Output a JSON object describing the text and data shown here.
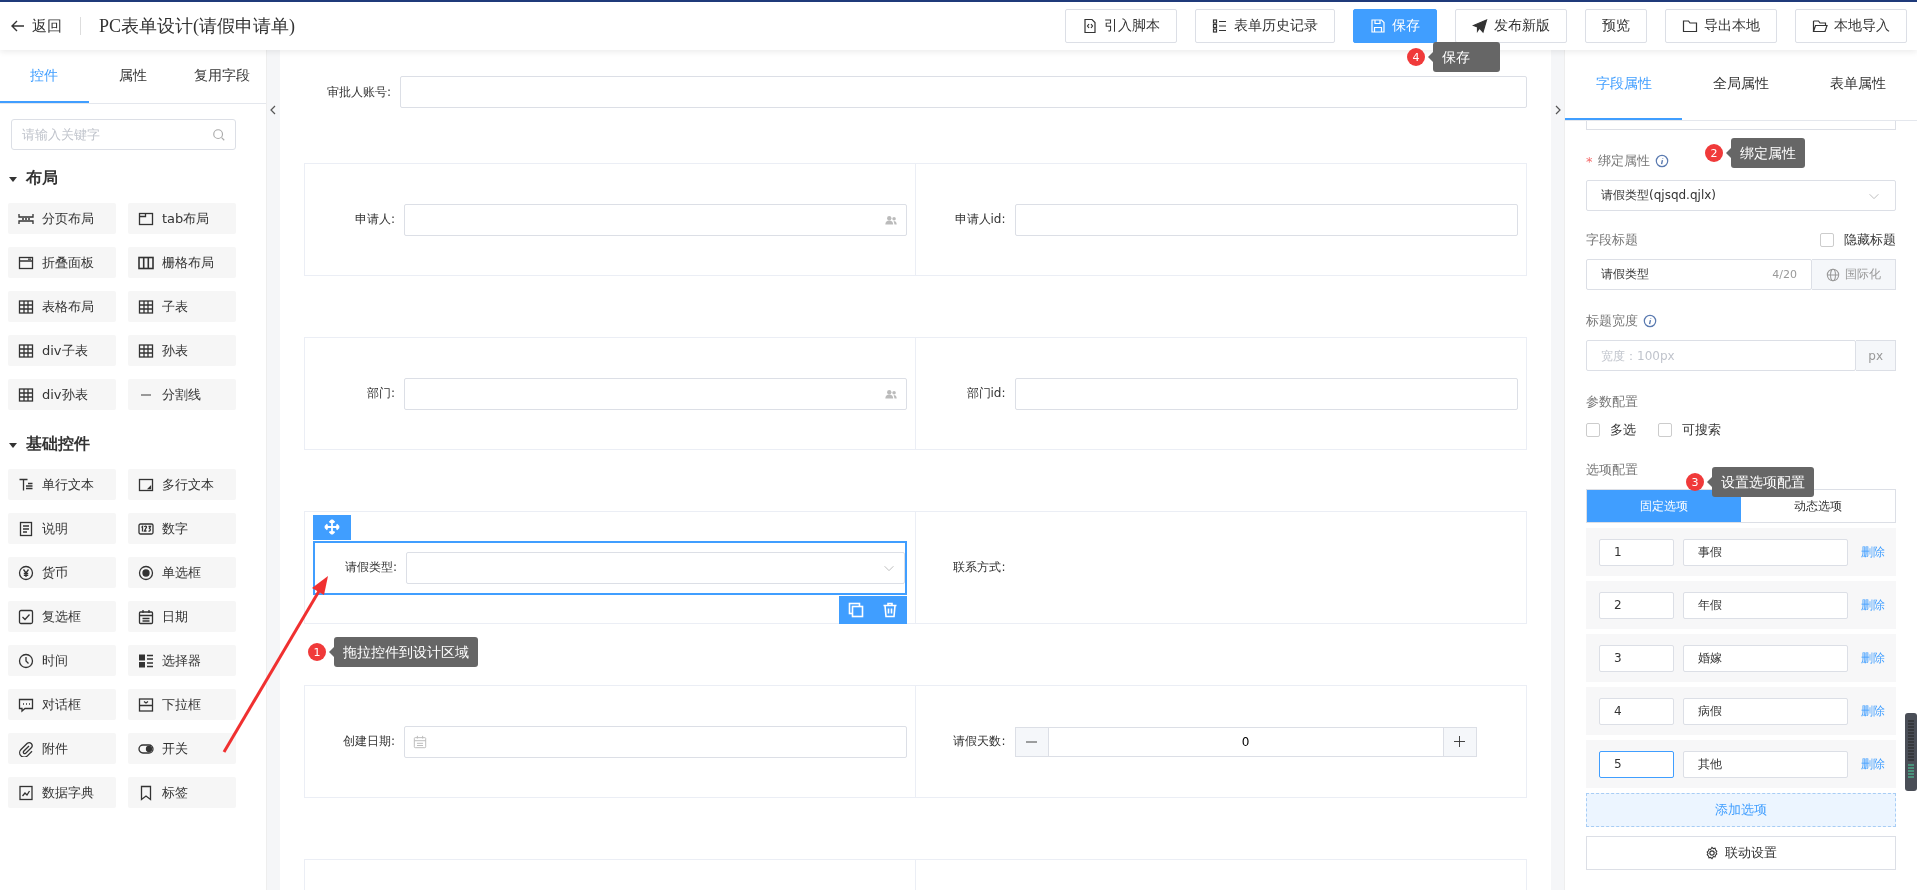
{
  "header": {
    "back": "返回",
    "title": "PC表单设计(请假申请单)",
    "buttons": [
      {
        "label": "引入脚本",
        "primary": false
      },
      {
        "label": "表单历史记录",
        "primary": false
      },
      {
        "label": "保存",
        "primary": true
      },
      {
        "label": "发布新版",
        "primary": false
      },
      {
        "label": "预览",
        "primary": false
      },
      {
        "label": "导出本地",
        "primary": false
      },
      {
        "label": "本地导入",
        "primary": false
      }
    ]
  },
  "left_panel": {
    "tabs": [
      {
        "label": "控件",
        "selected": true
      },
      {
        "label": "属性",
        "selected": false
      },
      {
        "label": "复用字段",
        "selected": false
      }
    ],
    "search": {
      "placeholder": "请输入关键字"
    },
    "groups": [
      {
        "title": "布局",
        "expanded": true,
        "items": [
          "分页布局",
          "tab布局",
          "折叠面板",
          "栅格布局",
          "表格布局",
          "子表",
          "div子表",
          "孙表",
          "div孙表",
          "分割线"
        ]
      },
      {
        "title": "基础控件",
        "expanded": true,
        "items": [
          "单行文本",
          "多行文本",
          "说明",
          "数字",
          "货币",
          "单选框",
          "复选框",
          "日期",
          "时间",
          "选择器",
          "对话框",
          "下拉框",
          "附件",
          "开关",
          "数据字典",
          "标签"
        ]
      }
    ]
  },
  "canvas": {
    "top_field": {
      "label": "审批人账号:"
    },
    "rows": [
      {
        "cells": [
          {
            "label": "申请人:",
            "kind": "user",
            "selected": false
          },
          {
            "label": "申请人id:",
            "kind": "text",
            "selected": false
          }
        ]
      },
      {
        "cells": [
          {
            "label": "部门:",
            "kind": "user",
            "selected": false
          },
          {
            "label": "部门id:",
            "kind": "text",
            "selected": false
          }
        ]
      },
      {
        "cells": [
          {
            "label": "请假类型:",
            "kind": "select",
            "selected": true
          },
          {
            "label": "联系方式:",
            "kind": "none",
            "selected": false
          }
        ]
      },
      {
        "cells": [
          {
            "label": "创建日期:",
            "kind": "date",
            "selected": false
          },
          {
            "label": "请假天数:",
            "kind": "number",
            "value": "0",
            "selected": false
          }
        ]
      }
    ]
  },
  "right_panel": {
    "tabs": [
      {
        "label": "字段属性",
        "selected": true
      },
      {
        "label": "全局属性",
        "selected": false
      },
      {
        "label": "表单属性",
        "selected": false
      }
    ],
    "bind": {
      "required_mark": "*",
      "label": "绑定属性",
      "value": "请假类型(qjsqd.qjlx)"
    },
    "title_field": {
      "label": "字段标题",
      "hide": {
        "label": "隐藏标题",
        "checked": false
      },
      "value": "请假类型",
      "count": "4/20",
      "i18n": "国际化"
    },
    "width_field": {
      "label": "标题宽度",
      "placeholder": "宽度：100px",
      "unit": "px"
    },
    "params": {
      "label": "参数配置",
      "options": [
        {
          "label": "多选",
          "checked": false
        },
        {
          "label": "可搜索",
          "checked": false
        }
      ]
    },
    "options": {
      "label": "选项配置",
      "modes": [
        {
          "label": "固定选项",
          "selected": true
        },
        {
          "label": "动态选项",
          "selected": false
        }
      ],
      "items": [
        {
          "value": "1",
          "text": "事假",
          "focused": false,
          "action": "删除"
        },
        {
          "value": "2",
          "text": "年假",
          "focused": false,
          "action": "删除"
        },
        {
          "value": "3",
          "text": "婚嫁",
          "focused": false,
          "action": "删除"
        },
        {
          "value": "4",
          "text": "病假",
          "focused": false,
          "action": "删除"
        },
        {
          "value": "5",
          "text": "其他",
          "focused": true,
          "action": "删除"
        }
      ],
      "add": "添加选项"
    },
    "linkage": "联动设置"
  },
  "annotations": [
    {
      "number": "1",
      "text": "拖拉控件到设计区域"
    },
    {
      "number": "2",
      "text": "绑定属性"
    },
    {
      "number": "3",
      "text": "设置选项配置"
    },
    {
      "number": "4",
      "text": "保存"
    }
  ]
}
